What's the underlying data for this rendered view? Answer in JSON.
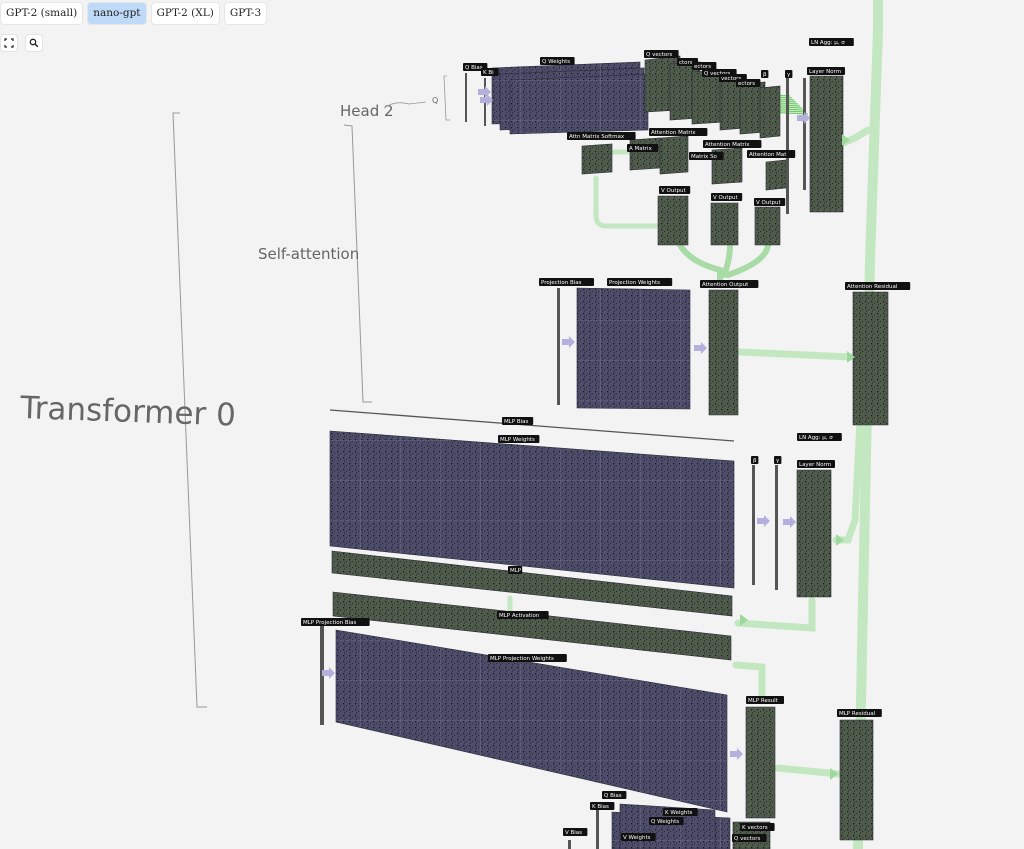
{
  "model_tabs": {
    "items": [
      "GPT-2 (small)",
      "nano-gpt",
      "GPT-2 (XL)",
      "GPT-3"
    ],
    "active": "nano-gpt"
  },
  "toolbar": {
    "fullscreen_icon": "fullscreen-icon",
    "search_icon": "search-icon"
  },
  "colors": {
    "background": "#f3f3f3",
    "tab_active": "#bfd9f9",
    "weight_matrix": "#4d4d6b",
    "activation_matrix": "#4f5c4b",
    "residual_flow": "#b6e3b4",
    "arrow": "#b3b0de",
    "label_bg": "#111111"
  },
  "annotations": {
    "transformer": "Transformer 0",
    "self_attention": "Self-attention",
    "head": "Head 2",
    "q": "Q"
  },
  "labels": {
    "q_bias": "Q Bias",
    "k_bias": "K Bi",
    "q_weights": "Q Weights",
    "q_vectors": "Q vectors",
    "vectors": "ctors",
    "ectors": "ectors",
    "q_vectors_2": "Q vectors",
    "vectors_2": "vectors",
    "ectors_2": "ectors",
    "b": "β",
    "y": "γ",
    "ln_agg": "LN Agg: μ, σ",
    "layer_norm": "Layer Norm",
    "attention_matrix": "Attention Matrix",
    "attn_matrix_softmax": "Attn Matrix Softmax",
    "a_matrix": "A Matrix",
    "attention_matrix_2": "Attention Matrix",
    "matrix_so": "Matrix So",
    "attention_mat": "Attention Mat",
    "v_output": "V Output",
    "v_output_2": "V Output",
    "v_output_3": "V Output",
    "projection_bias": "Projection Bias",
    "projection_weights": "Projection Weights",
    "attention_output": "Attention Output",
    "attention_residual": "Attention Residual",
    "mlp_bias": "MLP Bias",
    "mlp_weights": "MLP Weights",
    "ln_agg_2": "LN Agg: μ, σ",
    "b_2": "β",
    "y_2": "γ",
    "layer_norm_2": "Layer Norm",
    "mlp": "MLP",
    "mlp_activation": "MLP Activation",
    "mlp_projection_bias": "MLP Projection Bias",
    "mlp_projection_weights": "MLP Projection Weights",
    "mlp_result": "MLP Result",
    "mlp_residual": "MLP Residual",
    "q_bias_b": "Q Bias",
    "k_bias_b": "K Bias",
    "v_bias_b": "V Bias",
    "k_weights_b": "K Weights",
    "q_weights_b": "Q Weights",
    "v_weights_b": "V Weights",
    "k_vectors_b": "K vectors",
    "q_vectors_b": "Q vectors"
  }
}
